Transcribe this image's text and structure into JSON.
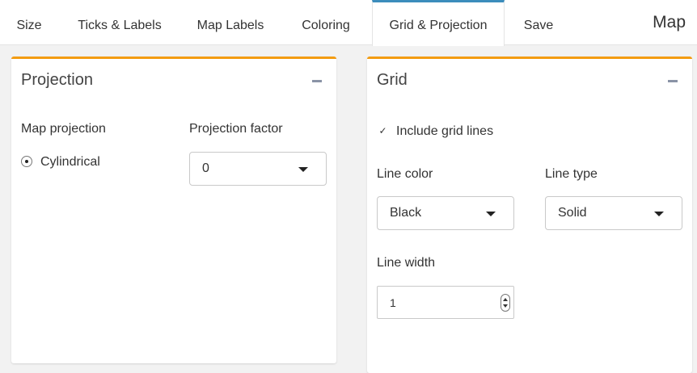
{
  "tabs": [
    {
      "label": "Size",
      "active": false
    },
    {
      "label": "Ticks & Labels",
      "active": false
    },
    {
      "label": "Map Labels",
      "active": false
    },
    {
      "label": "Coloring",
      "active": false
    },
    {
      "label": "Grid & Projection",
      "active": true
    },
    {
      "label": "Save",
      "active": false
    }
  ],
  "tab_title": "Map",
  "colors": {
    "active_tab_border": "#3c8dbc",
    "card_border": "#f39c12"
  },
  "projection": {
    "title": "Projection",
    "collapse_icon": "minus-icon",
    "map_projection_label": "Map projection",
    "radio_option": "Cylindrical",
    "radio_selected": true,
    "projection_factor_label": "Projection factor",
    "projection_factor_value": "0"
  },
  "grid": {
    "title": "Grid",
    "collapse_icon": "minus-icon",
    "include_grid_lines_label": "Include grid lines",
    "include_grid_lines_checked": true,
    "line_color_label": "Line color",
    "line_color_value": "Black",
    "line_type_label": "Line type",
    "line_type_value": "Solid",
    "line_width_label": "Line width",
    "line_width_value": "1"
  }
}
